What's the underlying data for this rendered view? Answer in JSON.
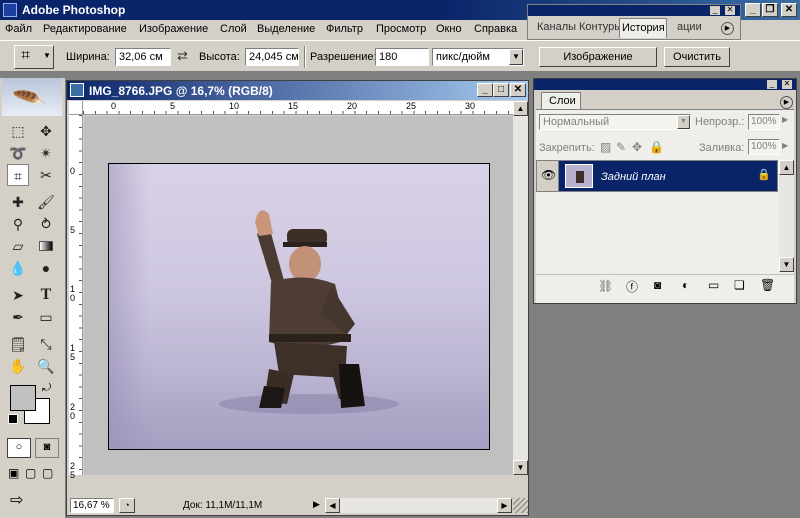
{
  "app": {
    "title": "Adobe Photoshop"
  },
  "menu": [
    "Файл",
    "Редактирование",
    "Изображение",
    "Слой",
    "Выделение",
    "Фильтр",
    "Просмотр",
    "Окно",
    "Справка"
  ],
  "options": {
    "width_label": "Ширина:",
    "width_value": "32,06 см",
    "height_label": "Высота:",
    "height_value": "24,045 см",
    "res_label": "Разрешение:",
    "res_value": "180",
    "units_value": "пикс/дюйм",
    "image_button": "Изображение",
    "clear_button": "Очистить"
  },
  "top_palette": {
    "tabs": [
      "Каналы",
      "Контуры",
      "История",
      "ации"
    ]
  },
  "document": {
    "title": "IMG_8766.JPG @ 16,7% (RGB/8)",
    "zoom": "16,67 %",
    "doc_info": "Док: 11,1M/11,1M",
    "ruler_h": [
      "0",
      "5",
      "10",
      "15",
      "20",
      "25",
      "30"
    ],
    "ruler_v": [
      "0",
      "5",
      "1 0",
      "1 5",
      "2 0",
      "2 5"
    ]
  },
  "layers": {
    "tab": "Слои",
    "blend_mode": "Нормальный",
    "opacity_label": "Непрозр.:",
    "opacity_value": "100%",
    "lock_label": "Закрепить:",
    "fill_label": "Заливка:",
    "fill_value": "100%",
    "items": [
      {
        "name": "Задний план"
      }
    ]
  }
}
